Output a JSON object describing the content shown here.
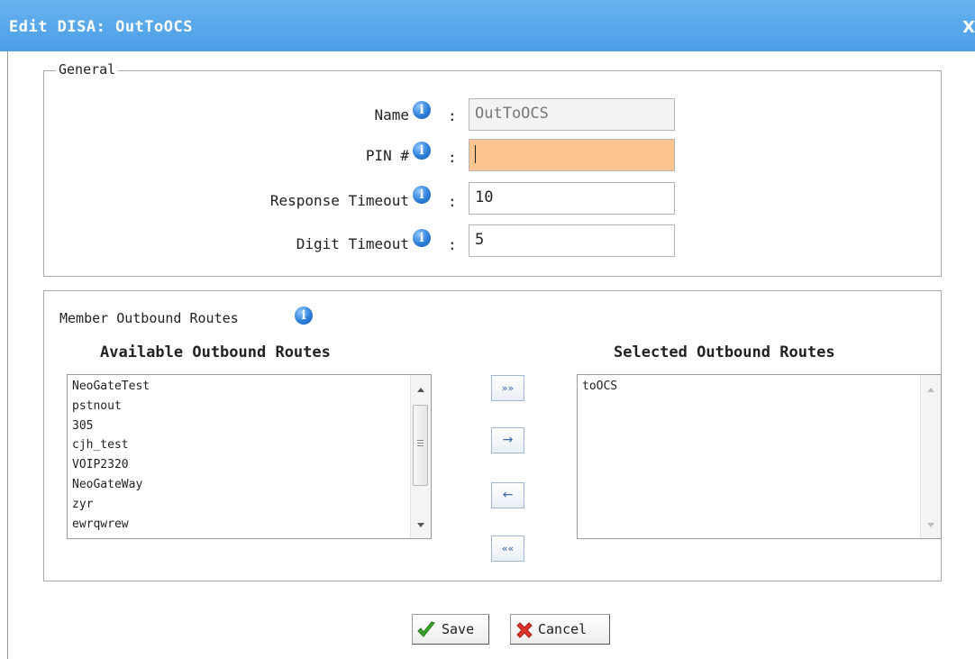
{
  "window": {
    "title": "Edit DISA: OutToOCS",
    "close_glyph": "X"
  },
  "general": {
    "legend": "General",
    "fields": [
      {
        "label": "Name",
        "value": "OutToOCS",
        "state": "read-only"
      },
      {
        "label": "PIN #",
        "value": "",
        "state": "focused"
      },
      {
        "label": "Response Timeout",
        "value": "10",
        "state": "normal"
      },
      {
        "label": "Digit Timeout",
        "value": "5",
        "state": "normal"
      }
    ],
    "colon": ":",
    "info_glyph": "i"
  },
  "routes": {
    "label": "Member Outbound Routes",
    "available_title": "Available Outbound Routes",
    "selected_title": "Selected Outbound Routes",
    "available": [
      "NeoGateTest",
      "pstnout",
      "305",
      "cjh_test",
      "VOIP2320",
      "NeoGateWay",
      "zyr",
      "ewrqwrew"
    ],
    "selected": [
      "toOCS"
    ],
    "move_buttons": {
      "add_all": "»»",
      "add": "→",
      "remove": "←",
      "remove_all": "««"
    }
  },
  "actions": {
    "save_label": "Save",
    "cancel_label": "Cancel"
  },
  "colors": {
    "titlebar": "#4b9ee6",
    "focused_input": "#fcc590",
    "info_icon": "#2e7fd9"
  }
}
